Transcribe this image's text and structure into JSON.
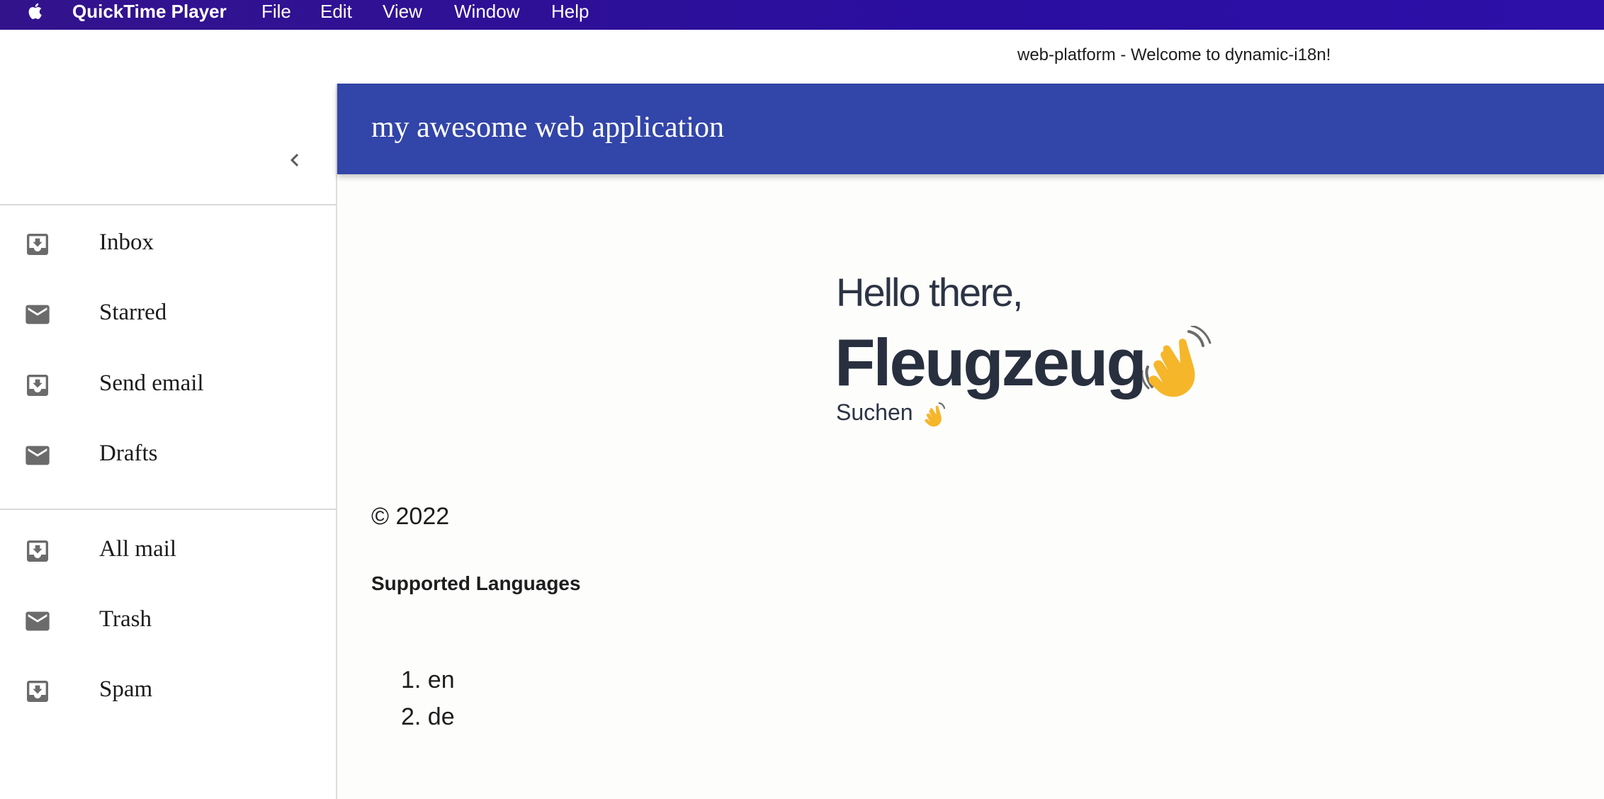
{
  "menubar": {
    "app_name": "QuickTime Player",
    "items": [
      "File",
      "Edit",
      "View",
      "Window",
      "Help"
    ]
  },
  "window": {
    "title": "web-platform - Welcome to dynamic-i18n!"
  },
  "appbar": {
    "title": "my awesome web application",
    "color": "#3245a8"
  },
  "drawer": {
    "group1": [
      {
        "label": "Inbox",
        "icon": "inbox-icon"
      },
      {
        "label": "Starred",
        "icon": "mail-icon"
      },
      {
        "label": "Send email",
        "icon": "inbox-icon"
      },
      {
        "label": "Drafts",
        "icon": "mail-icon"
      }
    ],
    "group2": [
      {
        "label": "All mail",
        "icon": "inbox-icon"
      },
      {
        "label": "Trash",
        "icon": "mail-icon"
      },
      {
        "label": "Spam",
        "icon": "inbox-icon"
      }
    ]
  },
  "main": {
    "greeting": "Hello there,",
    "name": "Fleugzeug",
    "search_label": "Suchen",
    "copyright": "© 2022",
    "languages_heading": "Supported Languages",
    "languages": [
      "1. en",
      "2. de"
    ]
  }
}
